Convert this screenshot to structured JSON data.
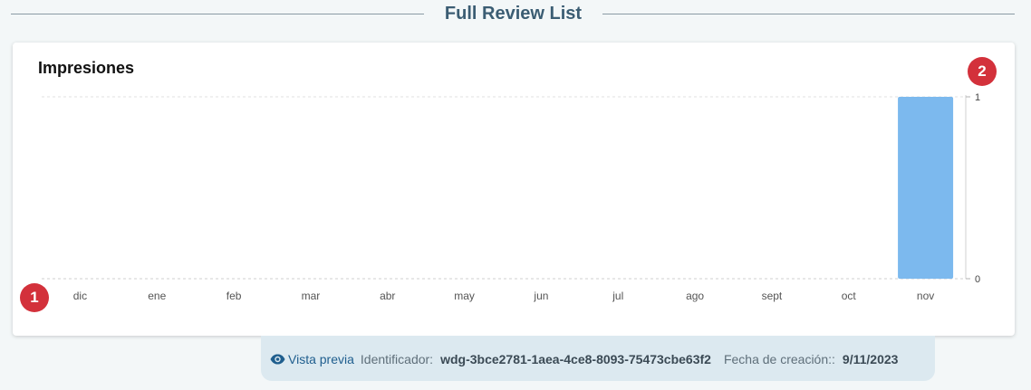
{
  "section": {
    "title": "Full Review List"
  },
  "card": {
    "title": "Impresiones"
  },
  "badges": {
    "one": "1",
    "two": "2"
  },
  "chart_data": {
    "type": "bar",
    "title": "Impresiones",
    "categories": [
      "dic",
      "ene",
      "feb",
      "mar",
      "abr",
      "may",
      "jun",
      "jul",
      "ago",
      "sept",
      "oct",
      "nov"
    ],
    "values": [
      0,
      0,
      0,
      0,
      0,
      0,
      0,
      0,
      0,
      0,
      0,
      1
    ],
    "y_ticks": [
      "1",
      "0"
    ],
    "ylim": [
      0,
      1
    ],
    "y_axis_side": "right",
    "grid": true,
    "bar_color": "#7cb9ee"
  },
  "footer": {
    "preview_label": "Vista previa",
    "id_label": "Identificador:",
    "id_value": "wdg-3bce2781-1aea-4ce8-8093-75473cbe63f2",
    "date_label": "Fecha de creación::",
    "date_value": "9/11/2023"
  },
  "colors": {
    "accent": "#1f5e8e",
    "badge": "#d3313b",
    "bar": "#7cb9ee"
  }
}
